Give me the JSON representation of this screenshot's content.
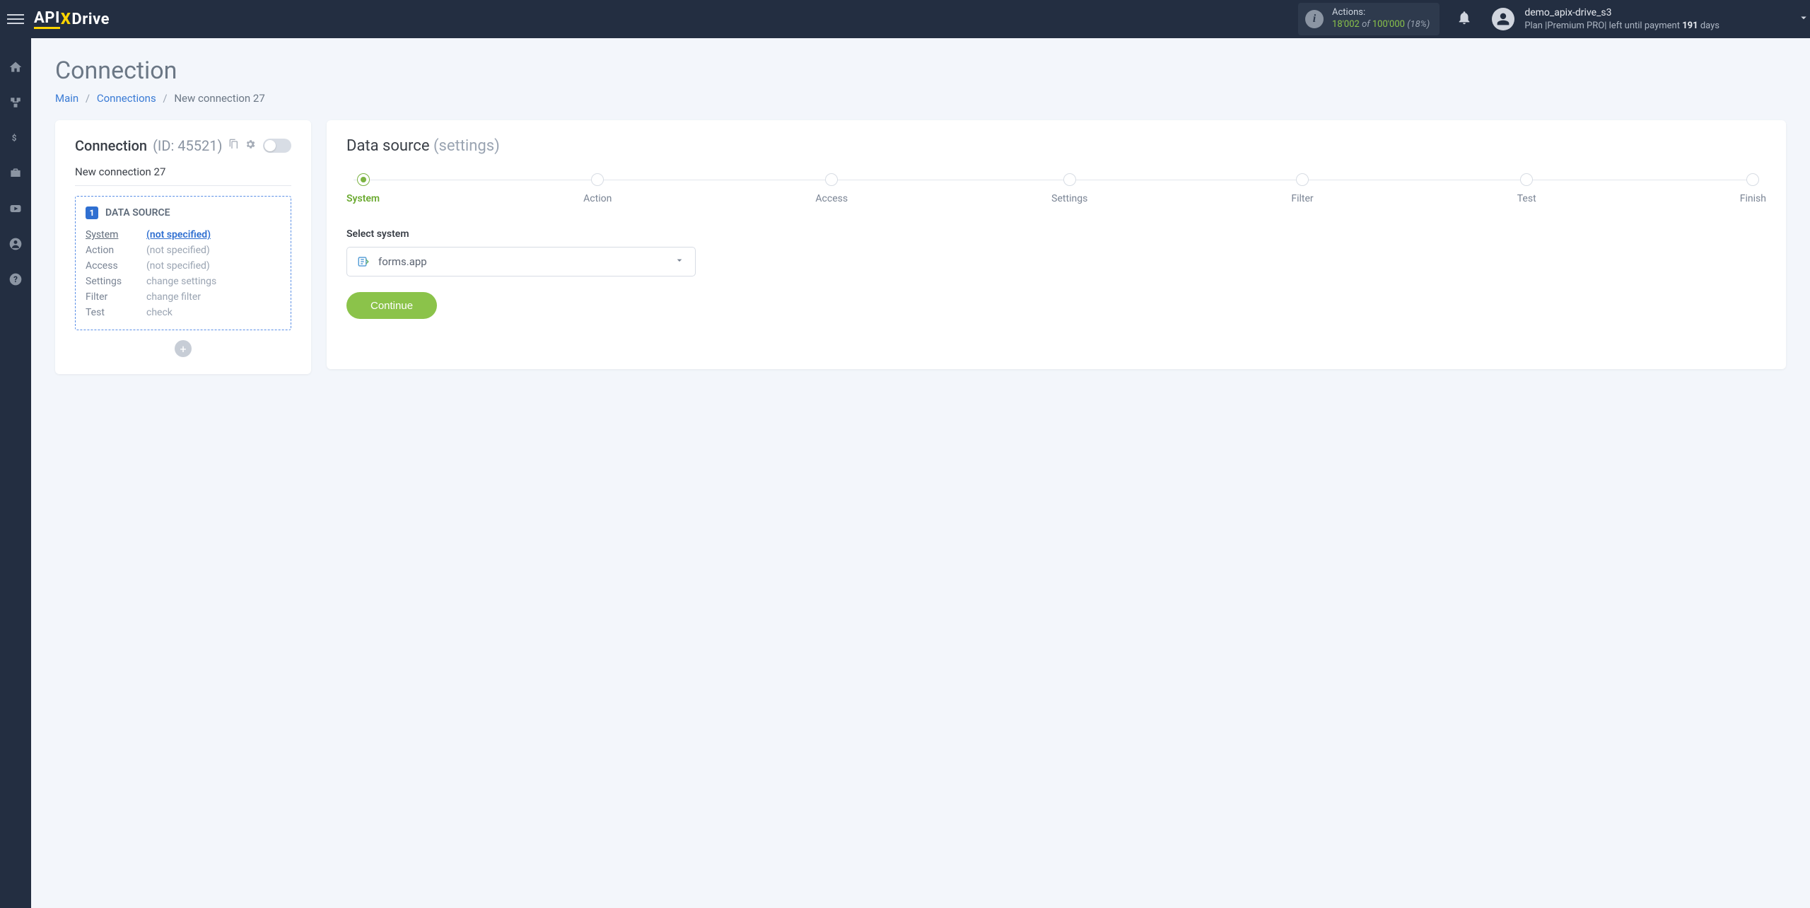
{
  "header": {
    "logo_pre": "API",
    "logo_x": "X",
    "logo_post": "Drive",
    "actions_label": "Actions:",
    "actions_used": "18'002",
    "actions_of": "of",
    "actions_total": "100'000",
    "actions_pct": "(18%)",
    "username": "demo_apix-drive_s3",
    "plan_prefix": "Plan |",
    "plan_name": "Premium PRO",
    "plan_mid": "| left until payment ",
    "plan_days": "191",
    "plan_suffix": " days"
  },
  "page": {
    "title": "Connection",
    "breadcrumb": {
      "main": "Main",
      "connections": "Connections",
      "current": "New connection 27"
    }
  },
  "left": {
    "heading": "Connection",
    "id_label": "(ID: 45521)",
    "name": "New connection 27",
    "badge_num": "1",
    "badge_label": "DATA SOURCE",
    "rows": [
      {
        "key": "System",
        "val": "(not specified)",
        "key_active": true,
        "val_link": true
      },
      {
        "key": "Action",
        "val": "(not specified)",
        "key_active": false,
        "val_link": false
      },
      {
        "key": "Access",
        "val": "(not specified)",
        "key_active": false,
        "val_link": false
      },
      {
        "key": "Settings",
        "val": "change settings",
        "key_active": false,
        "val_link": false
      },
      {
        "key": "Filter",
        "val": "change filter",
        "key_active": false,
        "val_link": false
      },
      {
        "key": "Test",
        "val": "check",
        "key_active": false,
        "val_link": false
      }
    ]
  },
  "right": {
    "heading": "Data source",
    "heading_sub": "(settings)",
    "steps": [
      "System",
      "Action",
      "Access",
      "Settings",
      "Filter",
      "Test",
      "Finish"
    ],
    "active_step": 0,
    "select_label": "Select system",
    "select_value": "forms.app",
    "continue": "Continue"
  }
}
